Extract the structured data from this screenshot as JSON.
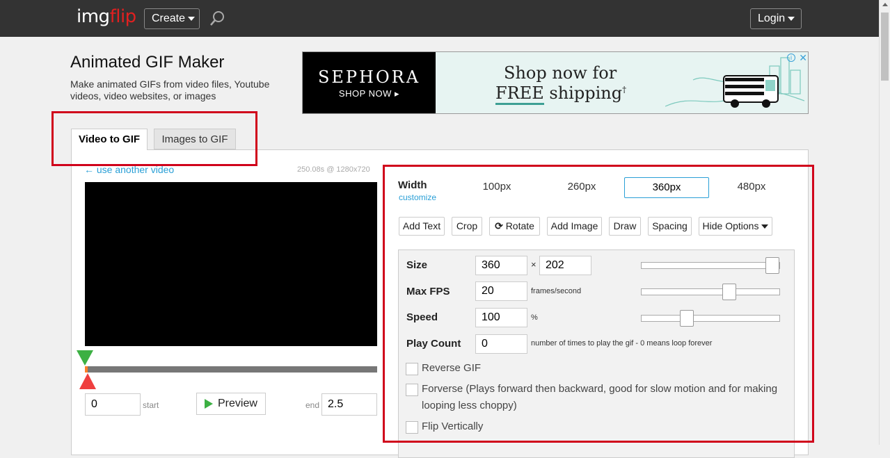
{
  "topbar": {
    "logo_part1": "img",
    "logo_part2": "flip",
    "create_label": "Create",
    "login_label": "Login",
    "search_icon": "search-icon"
  },
  "header": {
    "title": "Animated GIF Maker",
    "subtitle": "Make animated GIFs from video files, Youtube videos, video websites, or images"
  },
  "ad": {
    "brand": "SEPHORA",
    "cta": "SHOP NOW ▸",
    "line1": "Shop now for",
    "line2_a": "FREE",
    "line2_b": " shipping",
    "line2_sup": "†",
    "info": "i",
    "close": "✕"
  },
  "tabs": [
    {
      "label": "Video to GIF",
      "active": true
    },
    {
      "label": "Images to GIF",
      "active": false
    }
  ],
  "video": {
    "use_another": "← use another video",
    "meta": "250.08s @ 1280x720",
    "start_value": "0",
    "start_label": "start",
    "preview_label": "Preview",
    "end_label": "end",
    "end_value": "2.5"
  },
  "width": {
    "label": "Width",
    "customize": "customize",
    "options": [
      "100px",
      "260px",
      "360px",
      "480px"
    ],
    "selected": "360px"
  },
  "tools": [
    "Add Text",
    "Crop",
    "Rotate",
    "Add Image",
    "Draw",
    "Spacing",
    "Hide Options"
  ],
  "options": {
    "size_label": "Size",
    "size_w": "360",
    "size_x": "×",
    "size_h": "202",
    "fps_label": "Max FPS",
    "fps_value": "20",
    "fps_unit": "frames/second",
    "speed_label": "Speed",
    "speed_value": "100",
    "speed_unit": "%",
    "playcount_label": "Play Count",
    "playcount_value": "0",
    "playcount_unit": "number of times to play the gif - 0 means loop forever",
    "reverse_label": "Reverse GIF",
    "forverse_label": "Forverse (Plays forward then backward, good for slow motion and for making looping less choppy)",
    "flip_v_label": "Flip Vertically"
  },
  "sliders": {
    "size_level": 1.0,
    "fps_level": 0.65,
    "speed_level": 0.31
  },
  "colors": {
    "accent": "#2a9fd6",
    "highlight_box": "#d0021b",
    "start_marker": "#3cb043",
    "end_marker": "#ef3f3f"
  }
}
